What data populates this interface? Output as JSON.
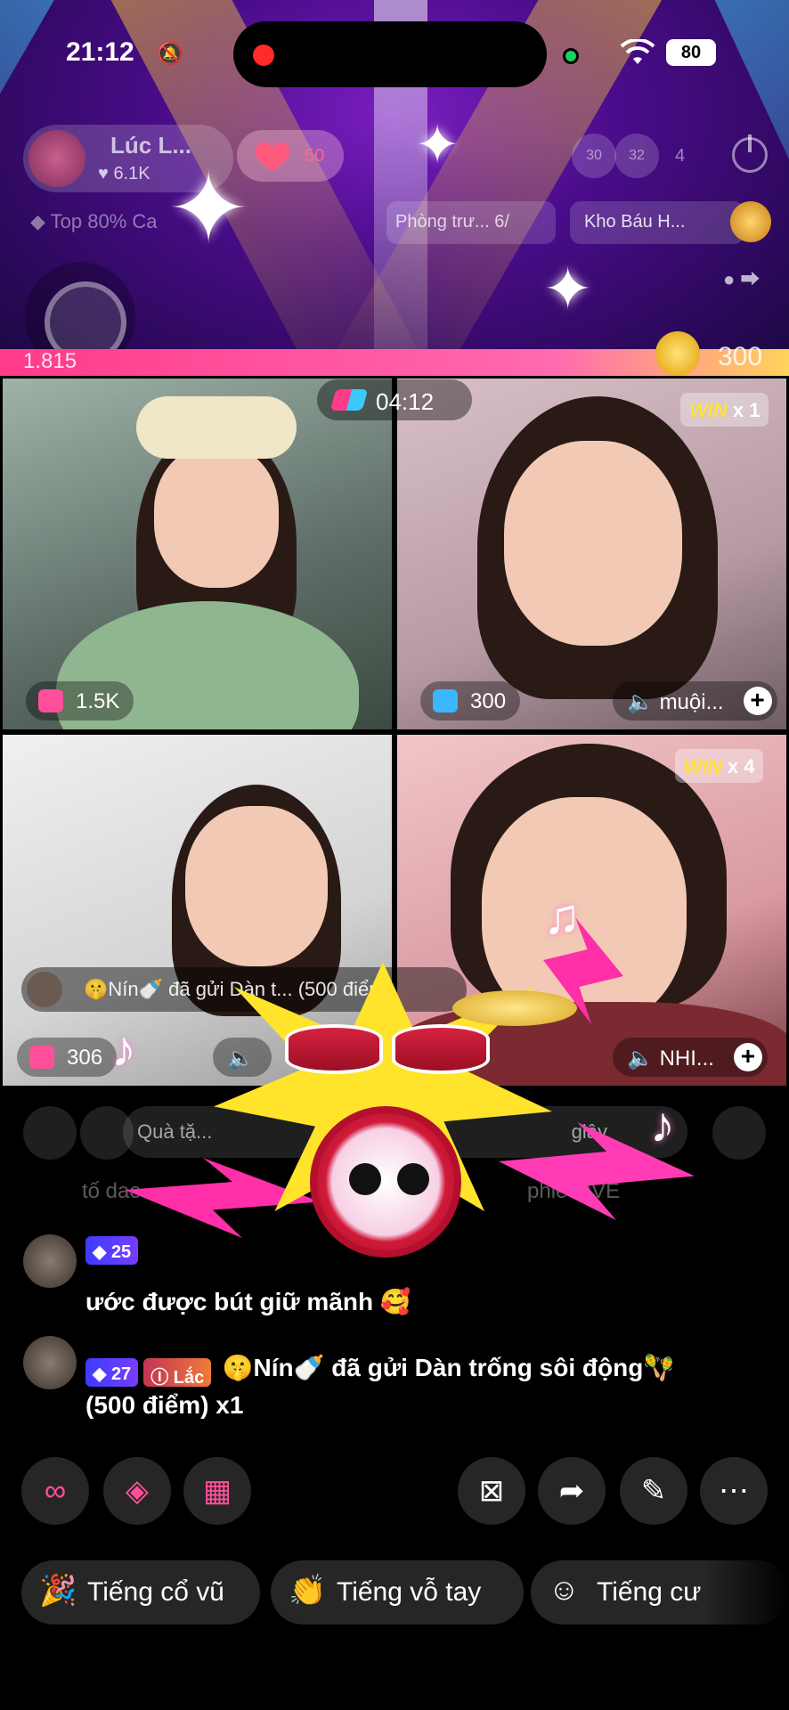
{
  "status_bar": {
    "time": "21:12",
    "battery": "80"
  },
  "host": {
    "name": "Lúc L...",
    "likes": "6.1K",
    "heart_count": "50"
  },
  "viewers": {
    "bubble1": "30",
    "bubble2": "32",
    "count": "4"
  },
  "chips": {
    "rank": "Top 80% Ca",
    "room": "Phòng trư...  6/",
    "treasure": "Kho Báu H..."
  },
  "score": {
    "left": "1.815",
    "right": "300"
  },
  "timer": "04:12",
  "tiles": [
    {
      "score": "1.5K"
    },
    {
      "score": "300",
      "mic_name": "muội...",
      "win": "WIN",
      "win_count": "x 1"
    },
    {
      "score": "306"
    },
    {
      "mic_name": "NHI...",
      "win": "WIN",
      "win_count": "x 4"
    }
  ],
  "gift_toast": {
    "text": "🤫Nín🍼 đã gửi Dàn t...  (500 điểm)"
  },
  "gift_strip": {
    "left": "Quà tặ...",
    "right": "giây"
  },
  "faded_lines": {
    "line1": "tố  dao",
    "line1_right": "phiê  LIVE"
  },
  "comments": [
    {
      "level": "25",
      "text": "ước được bút giữ mãnh 🥰"
    },
    {
      "level": "27",
      "fan_label": "Lắc",
      "text": "🤫Nín🍼 đã gửi Dàn trống sôi động🪇",
      "text2": "(500 điểm) x1"
    }
  ],
  "quick_replies": [
    {
      "label": "Tiếng cổ vũ"
    },
    {
      "label": "Tiếng vỗ tay"
    },
    {
      "label": "Tiếng cư"
    }
  ],
  "colors": {
    "accent_pink": "#ff4f9a",
    "level_blue": "#3c3cff",
    "win_yellow": "#ffe23a"
  }
}
